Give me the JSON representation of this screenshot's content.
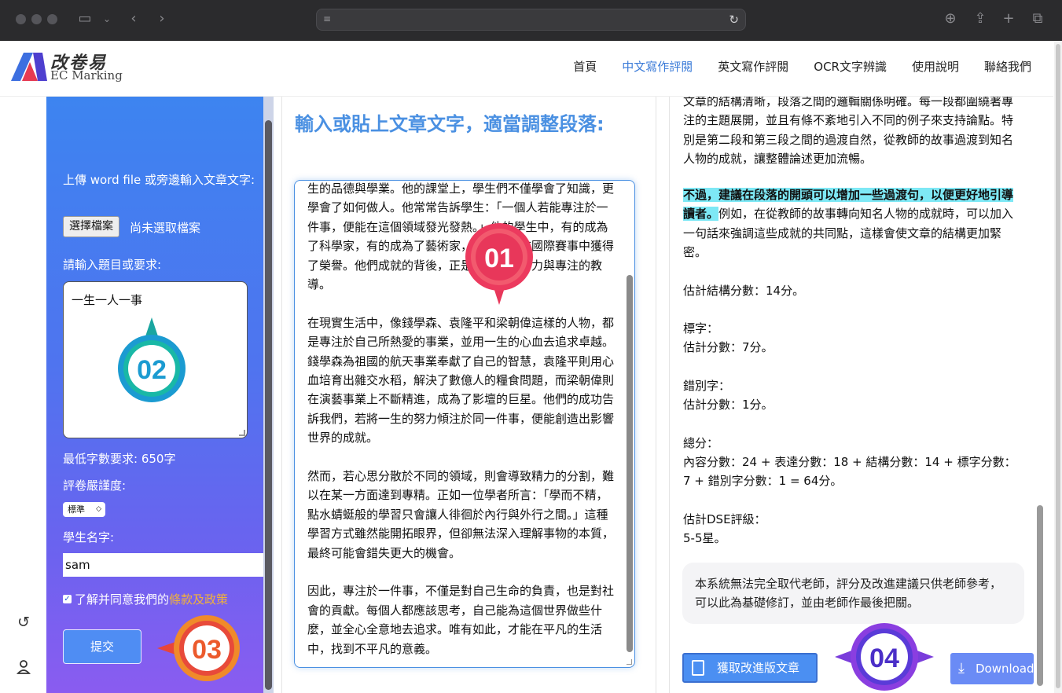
{
  "browser": {
    "url": ""
  },
  "header": {
    "logo_cn": "改卷易",
    "logo_en": "EC Marking",
    "nav": [
      "首頁",
      "中文寫作評閱",
      "英文寫作評閱",
      "OCR文字辨識",
      "使用說明",
      "聯絡我們"
    ]
  },
  "sidebar": {
    "upload_label": "上傳 word file 或旁邊輸入文章文字:",
    "choose_file": "選擇檔案",
    "no_file": "尚未選取檔案",
    "topic_label": "請輸入題目或要求:",
    "topic_value": "一生一人一事",
    "min_words": "最低字數要求: 650字",
    "strictness_label": "評卷嚴謹度:",
    "strictness_value": "標準",
    "student_label": "學生名字:",
    "student_value": "sam",
    "agree_text": "了解并同意我們的",
    "agree_link": "條款及政策",
    "submit": "提交"
  },
  "middle": {
    "title": "輸入或貼上文章文字，適當調整段落:",
    "paragraphs": [
      "生的品德與學業。他的課堂上，學生們不僅學會了知識，更學會了如何做人。他常常告訴學生：「一個人若能專注於一件事，便能在這個領域發光發熱。」他的學生中，有的成為了科學家，有的成為了藝術家，甚至有的在國際賽事中獲得了榮譽。他們成就的背後，正是他不懈的努力與專注的教導。",
      "在現實生活中，像錢學森、袁隆平和梁朝偉這樣的人物，都是專注於自己所熱愛的事業，並用一生的心血去追求卓越。錢學森為祖國的航天事業奉獻了自己的智慧，袁隆平則用心血培育出雜交水稻，解決了數億人的糧食問題，而梁朝偉則在演藝事業上不斷精進，成為了影壇的巨星。他們的成功告訴我們，若將一生的努力傾注於同一件事，便能創造出影響世界的成就。",
      "然而，若心思分散於不同的領域，則會導致精力的分割，難以在某一方面達到專精。正如一位學者所言：「學而不精，點水蜻蜓般的學習只會讓人徘徊於內行與外行之間。」這種學習方式雖然能開拓眼界，但卻無法深入理解事物的本質，最終可能會錯失更大的機會。",
      "因此，專注於一件事，不僅是對自己生命的負責，也是對社會的貢獻。每個人都應該思考，自己能為這個世界做些什麼，並全心全意地去追求。唯有如此，才能在平凡的生活中，找到不平凡的意義。"
    ]
  },
  "right": {
    "para1": "文章的結構清晰，段落之間的邏輯關係明確。每一段都圍繞著專注的主題展開，並且有條不紊地引入不同的例子來支持論點。特別是第二段和第三段之間的過渡自然，從教師的故事過渡到知名人物的成就，讓整體論述更加流暢。",
    "highlight": "不過，建議在段落的開頭可以增加一些過渡句，以便更好地引導讀者。",
    "para2_rest": "例如，在從教師的故事轉向知名人物的成就時，可以加入一句話來強調這些成就的共同點，這樣會使文章的結構更加緊密。",
    "structure_score": "估計結構分數：14分。",
    "char_label": "標字：",
    "char_score": "估計分數：7分。",
    "typo_label": "錯別字：",
    "typo_score": "估計分數：1分。",
    "total_label": "總分：",
    "total_value": "內容分數：24 + 表達分數：18 + 結構分數：14 + 標字分數：7 + 錯別字分數：1 = 64分。",
    "dse_label": "估計DSE評級：",
    "dse_value": "5-5星。",
    "disclaimer": "本系統無法完全取代老師，評分及改進建議只供老師參考，可以此為基礎修訂，並由老師作最後把關。",
    "improve_btn": "獲取改進版文章",
    "download_btn": "Download"
  },
  "badges": {
    "b1": "01",
    "b2": "02",
    "b3": "03",
    "b4": "04"
  },
  "colors": {
    "accent": "#4a90e2",
    "highlight": "#7ee8f5",
    "link": "#f2b23a"
  }
}
